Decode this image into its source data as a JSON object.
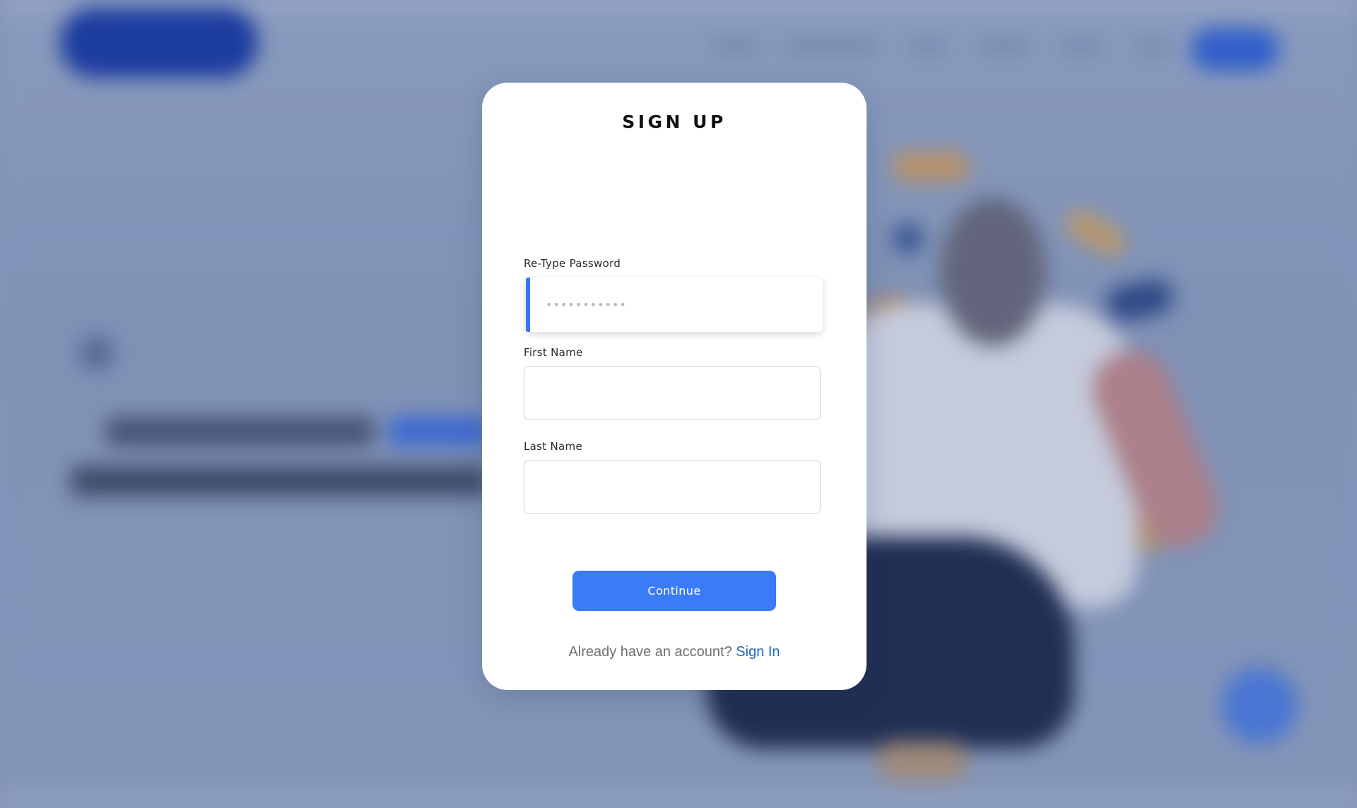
{
  "modal": {
    "title": "SIGN UP",
    "fields": {
      "retype_password": {
        "label": "Re-Type Password",
        "value": "",
        "placeholder": "•••••••••••"
      },
      "first_name": {
        "label": "First Name",
        "value": "",
        "placeholder": ""
      },
      "last_name": {
        "label": "Last Name",
        "value": "",
        "placeholder": ""
      }
    },
    "continue_label": "Continue",
    "footer": {
      "prompt": "Already have an account?",
      "link_label": "Sign In"
    }
  },
  "colors": {
    "accent": "#3a7bf7",
    "focus_bar": "#3a78f2",
    "link": "#1f67b5",
    "background_overlay": "#93a3c2"
  }
}
